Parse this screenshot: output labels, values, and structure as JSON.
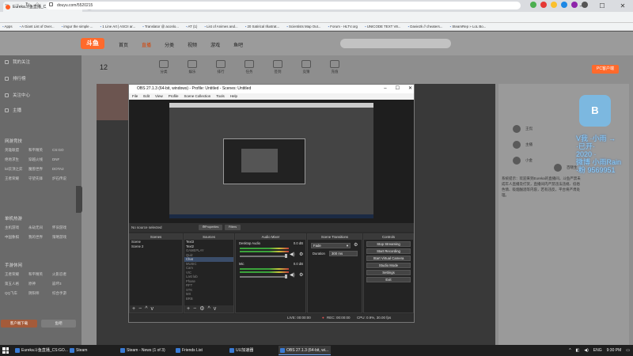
{
  "browser": {
    "tab_title": "Eureka斗鱼直播_CS:GO直播_斗鱼直",
    "url": "douyu.com/5520215",
    "bookmarks": [
      "Apps",
      "A Giant List of Over...",
      "imgur the simple ...",
      "1 Line Art | ASCII ar...",
      "Translator @ aconlo...",
      "AT (1)",
      "List of Animes and...",
      "20 Satirical Illustrat...",
      "Scientists Map Out...",
      "Forum - HLTV.org",
      "UNICODE TEXT V8...",
      "Davie2k // cheaters...",
      "SteamRep » LoL Bo..."
    ]
  },
  "douyu": {
    "logo": "斗鱼",
    "nav": [
      "首页",
      "直播",
      "分类",
      "视频",
      "游戏",
      "鱼吧"
    ],
    "nav_active": 1,
    "sidebar_top": [
      "我的关注",
      "排行榜",
      "关注中心",
      "主播"
    ],
    "sidebar_sec1": "网游竞技",
    "sidebar_sec1_items": [
      "英雄联盟",
      "和平精英",
      "CS:GO",
      "绝地求生",
      "穿越火线",
      "DNF",
      "lol云顶之弈",
      "魔兽世界",
      "DOTA2",
      "王者荣耀",
      "守望先锋",
      "炉石传说"
    ],
    "sidebar_sec2": "单机热游",
    "sidebar_sec2_items": [
      "主机游戏",
      "永劫无间",
      "怀旧游戏",
      "中国象棋",
      "我的世界",
      "策略游戏"
    ],
    "sidebar_sec3": "手游休闲",
    "sidebar_sec3_items": [
      "王者荣耀",
      "和平精英",
      "火影忍者",
      "第五人格",
      "原神",
      "崩坏3",
      "QQ飞车",
      "阴阳师",
      "综合手游"
    ],
    "sidebar_btn1": "客户端下载",
    "sidebar_btn2": "鱼吧",
    "count": "12",
    "categories": [
      "分类",
      "娱乐",
      "排行",
      "任务",
      "签到",
      "竞猜",
      "充值"
    ],
    "pc_button": "PC客户端",
    "user_rows": [
      "王侃",
      "主播",
      "小金",
      "百晓生"
    ],
    "chat": "系统提示：欢迎来到Eureka的直播间，斗鱼严禁未成年人直播及打赏，直播间内严禁违法违规、低俗色情、吸烟酗酒等内容，若有违反，平台将严肃处理。",
    "overlay_text": "V我 ·小雨 →\n·已开·\n2020 ·\n微博 小雨Rain\n·粉 9569951"
  },
  "obs": {
    "title": "OBS 27.1.3 (64-bit, windows) - Profile: Untitled - Scenes: Untitled",
    "menu": [
      "File",
      "Edit",
      "View",
      "Profile",
      "Scene Collection",
      "Tools",
      "Help"
    ],
    "no_source": "No source selected",
    "properties": "Properties",
    "filters": "Filters",
    "docks": {
      "scenes": {
        "title": "Scenes",
        "items": [
          "Scene",
          "Scene 2"
        ]
      },
      "sources": {
        "title": "Sources",
        "items": [
          "Text3",
          "Text2",
          "GAMEPLAY",
          "Quiz",
          "Chat",
          "MUSIC",
          "Cam",
          "VIC",
          "Last lab",
          "Phase",
          "RFT",
          "STK",
          "MX",
          "BRB"
        ]
      },
      "mixer": {
        "title": "Audio Mixer",
        "channels": [
          {
            "name": "Desktop Audio",
            "db": "0.0 dB"
          },
          {
            "name": "Mic",
            "db": "0.0 dB"
          }
        ]
      },
      "transitions": {
        "title": "Scene Transitions",
        "value": "Fade",
        "duration_label": "Duration",
        "duration": "300 ms"
      },
      "controls": {
        "title": "Controls",
        "buttons": [
          "Stop Streaming",
          "Start Recording",
          "Start Virtual Camera",
          "Studio Mode",
          "Settings",
          "Exit"
        ]
      }
    },
    "status": {
      "live": "LIVE: 00:00:00",
      "rec": "REC: 00:00:00",
      "cpu": "CPU: 0.9%, 30.00 fps"
    }
  },
  "taskbar": {
    "items": [
      "Eureka斗鱼直播_CS:GO...",
      "Steam",
      "Steam - News (1 of 3)",
      "Friends List",
      "UU加速器",
      "OBS 27.1.3 (64-bit, wi..."
    ],
    "active": 5,
    "lang": "ENG",
    "time": "9:30 PM"
  }
}
